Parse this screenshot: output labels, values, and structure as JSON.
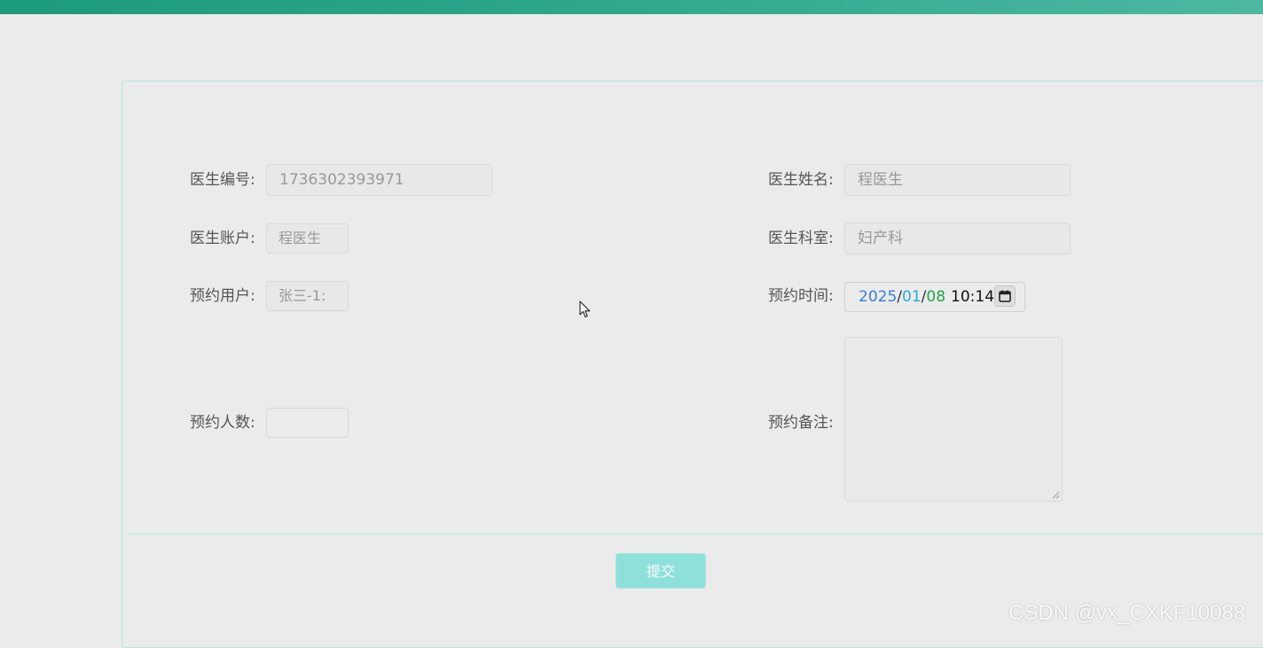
{
  "form": {
    "doctor_id": {
      "label": "医生编号:",
      "value": "1736302393971"
    },
    "doctor_name": {
      "label": "医生姓名:",
      "value": "程医生"
    },
    "doctor_account": {
      "label": "医生账户:",
      "value": "程医生"
    },
    "doctor_department": {
      "label": "医生科室:",
      "value": "妇产科"
    },
    "booking_user": {
      "label": "预约用户:",
      "value": "张三-1:"
    },
    "booking_time": {
      "label": "预约时间:",
      "year": "2025",
      "month": "01",
      "day": "08",
      "separator": "/",
      "time": "10:14"
    },
    "booking_count": {
      "label": "预约人数:",
      "value": ""
    },
    "booking_remark": {
      "label": "预约备注:",
      "value": ""
    },
    "submit_label": "提交"
  },
  "watermark": "CSDN @vx_CXKF10088",
  "colors": {
    "top_bar": "#1e9a7c",
    "panel_border": "#b8e3e0",
    "submit_bg": "#8ee1da"
  }
}
